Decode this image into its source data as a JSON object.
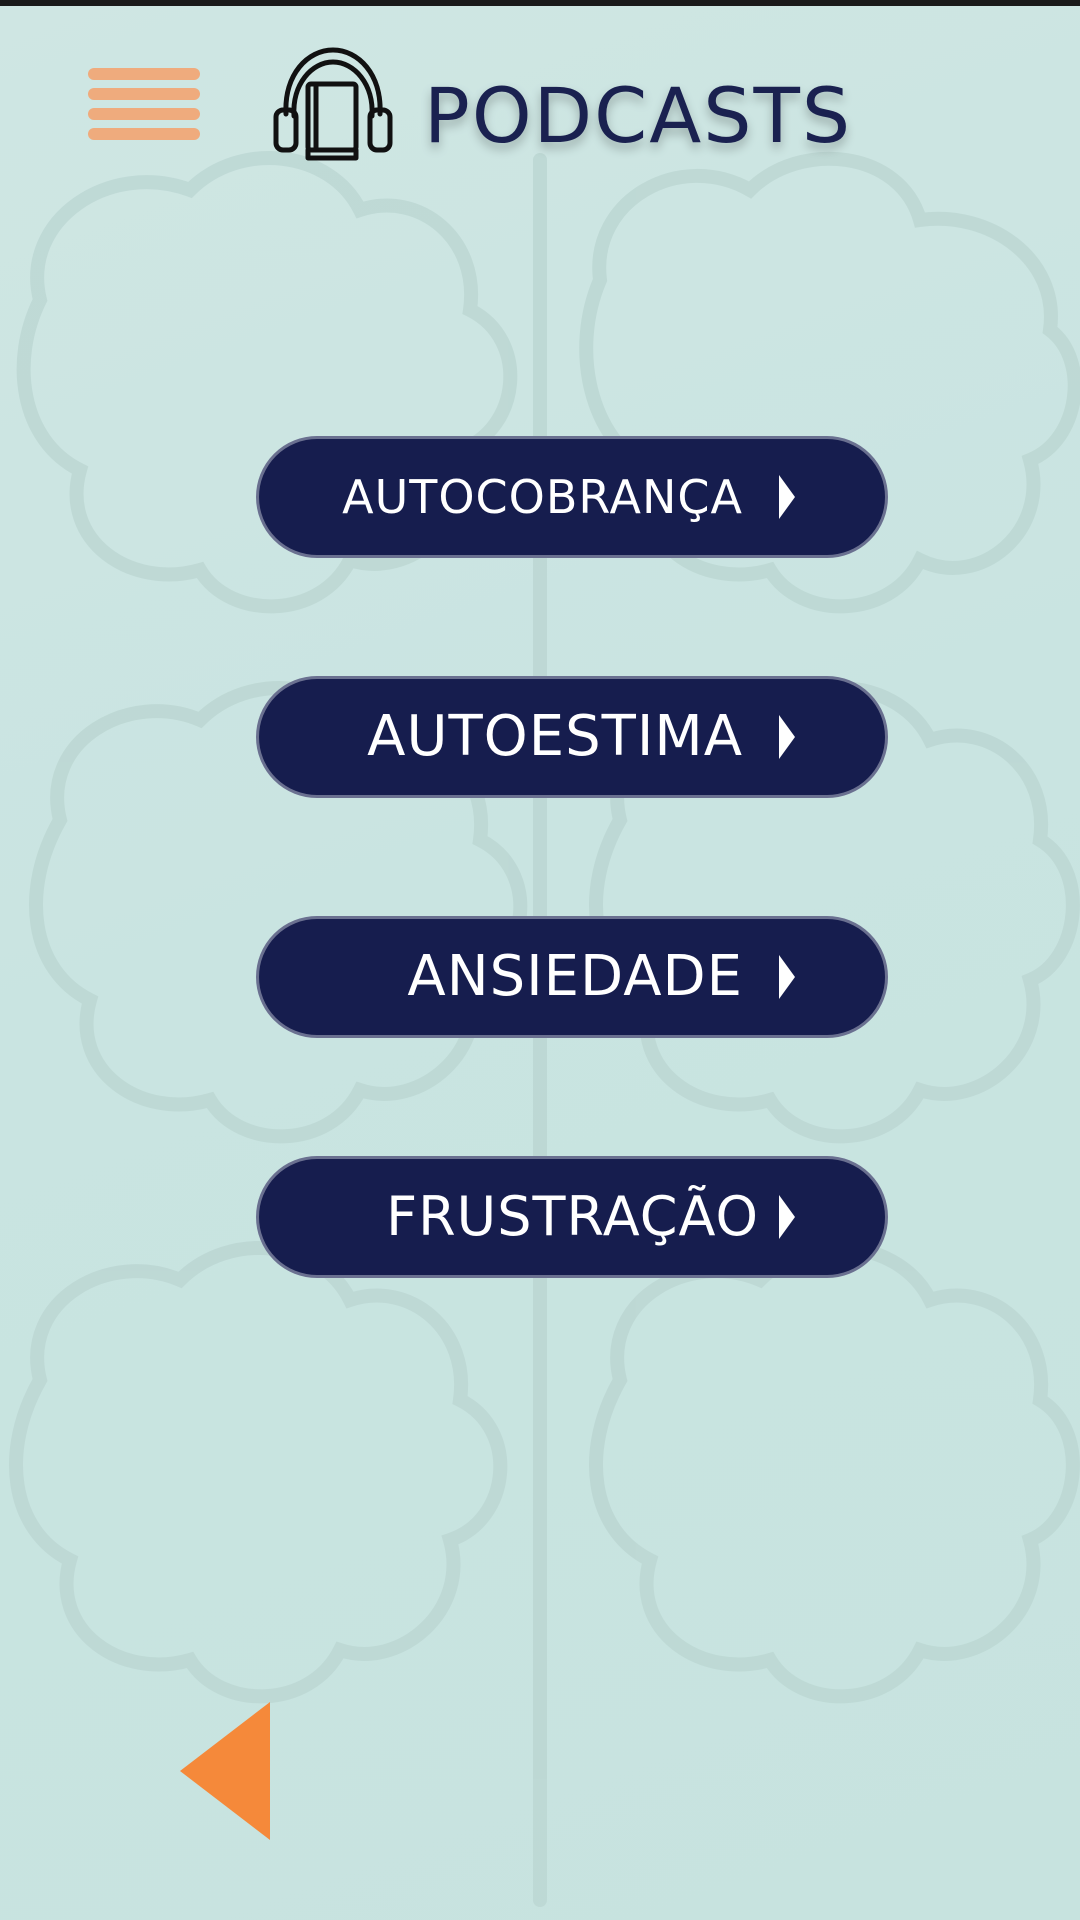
{
  "header": {
    "title": "PODCASTS",
    "menu_icon": "hamburger-menu-icon",
    "title_icon": "headphones-book-icon"
  },
  "topics": [
    {
      "label": "AUTOCOBRANÇA",
      "icon": "chevron-right-icon"
    },
    {
      "label": "AUTOESTIMA",
      "icon": "chevron-right-icon"
    },
    {
      "label": "ANSIEDADE",
      "icon": "chevron-right-icon"
    },
    {
      "label": "FRUSTRAÇÃO",
      "icon": "chevron-right-icon"
    }
  ],
  "footer": {
    "back_icon": "back-arrow-icon"
  },
  "colors": {
    "background": "#cbe4e1",
    "button_fill": "#161d4e",
    "button_text": "#ffffff",
    "title_text": "#1a2150",
    "menu_accent": "#efab7d",
    "back_accent": "#f5893a"
  }
}
